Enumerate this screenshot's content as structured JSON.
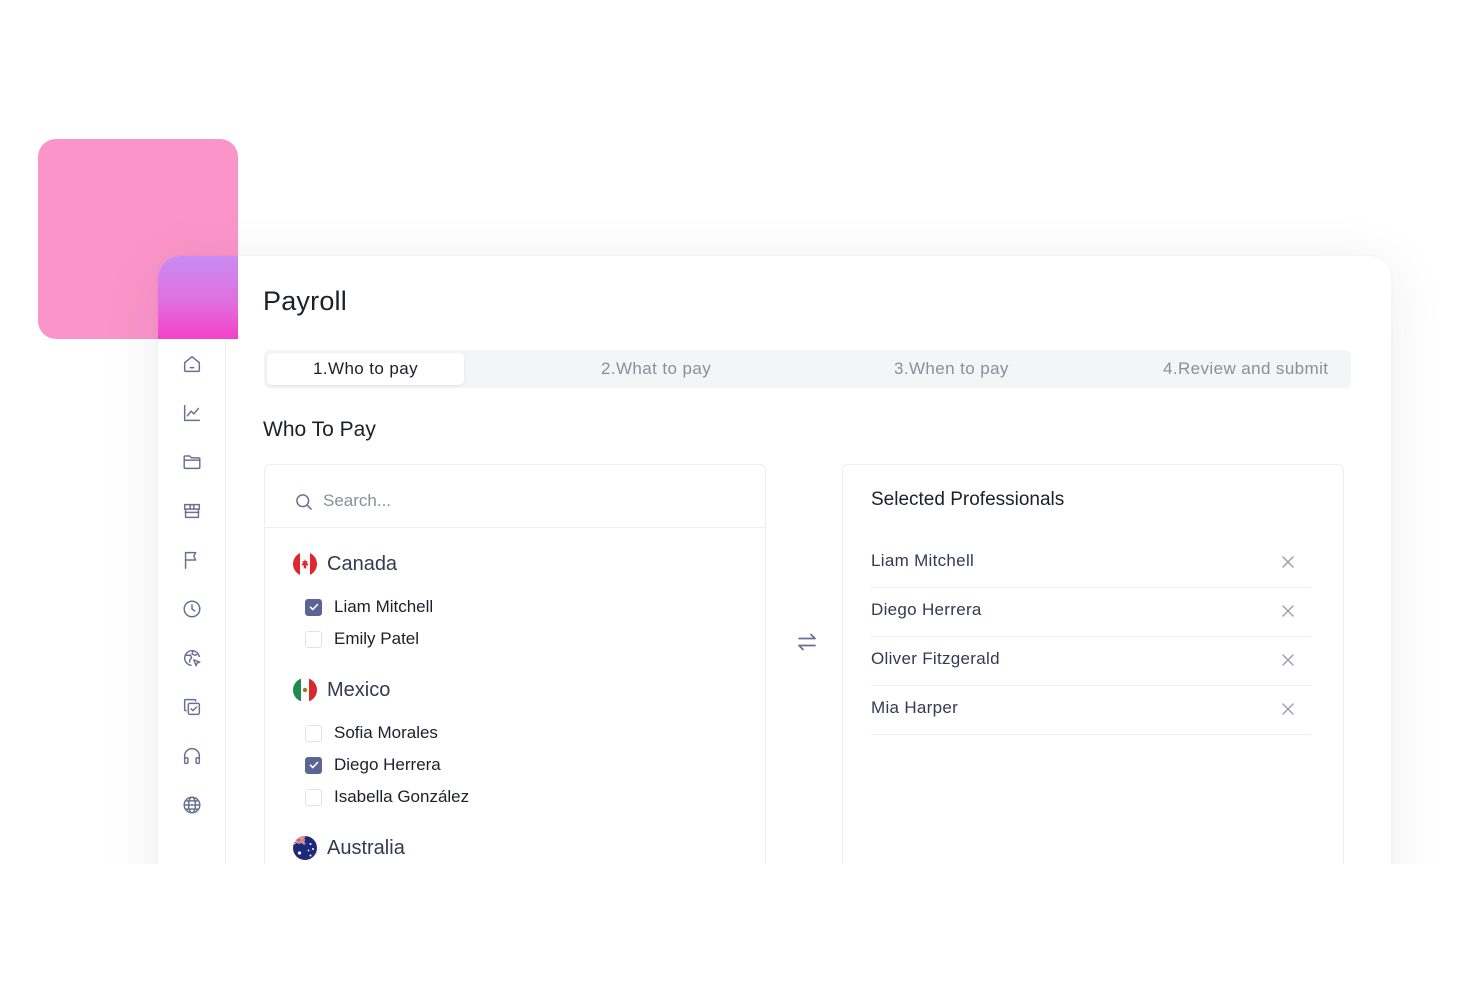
{
  "page": {
    "title": "Payroll"
  },
  "colors": {
    "accent": "#5c6494",
    "pink": "#fb95c9",
    "gradient_top": "#c88cf2",
    "gradient_bottom": "#f541c8",
    "muted_text": "#8a8f9c"
  },
  "sidebar": {
    "icons": [
      "home-icon",
      "chart-icon",
      "folder-icon",
      "store-icon",
      "flag-icon",
      "clock-icon",
      "globe-cursor-icon",
      "copy-check-icon",
      "headphones-icon",
      "globe-icon"
    ]
  },
  "stepper": {
    "steps": [
      {
        "label": "1.Who to pay",
        "active": true
      },
      {
        "label": "2.What to pay",
        "active": false
      },
      {
        "label": "3.When to pay",
        "active": false
      },
      {
        "label": "4.Review and submit",
        "active": false
      }
    ]
  },
  "who_to_pay": {
    "title": "Who To Pay",
    "search": {
      "placeholder": "Search...",
      "value": ""
    },
    "groups": [
      {
        "country": "Canada",
        "flag": "canada-flag-icon",
        "people": [
          {
            "name": "Liam Mitchell",
            "checked": true
          },
          {
            "name": "Emily Patel",
            "checked": false
          }
        ]
      },
      {
        "country": "Mexico",
        "flag": "mexico-flag-icon",
        "people": [
          {
            "name": "Sofia Morales",
            "checked": false
          },
          {
            "name": "Diego Herrera",
            "checked": true
          },
          {
            "name": "Isabella González",
            "checked": false
          }
        ]
      },
      {
        "country": "Australia",
        "flag": "australia-flag-icon",
        "people": []
      }
    ]
  },
  "transfer": {
    "icon": "swap-arrows-icon"
  },
  "selected": {
    "title": "Selected Professionals",
    "items": [
      {
        "name": "Liam Mitchell"
      },
      {
        "name": "Diego Herrera"
      },
      {
        "name": "Oliver Fitzgerald"
      },
      {
        "name": "Mia Harper"
      }
    ]
  }
}
